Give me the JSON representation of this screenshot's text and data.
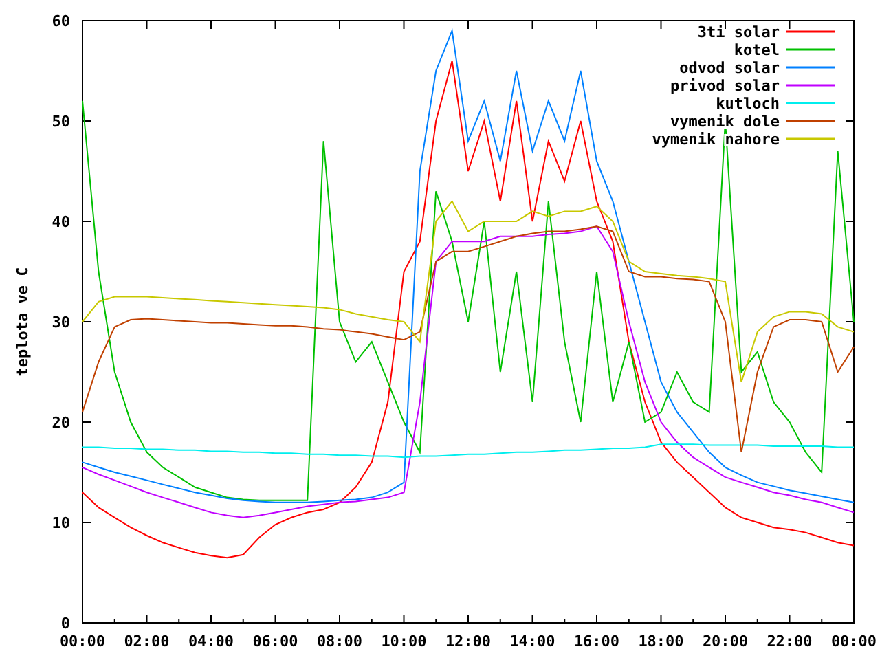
{
  "chart_data": {
    "type": "line",
    "ylabel": "teplota ve C",
    "legend": true,
    "x": [
      0,
      0.5,
      1,
      1.5,
      2,
      2.5,
      3,
      3.5,
      4,
      4.5,
      5,
      5.5,
      6,
      6.5,
      7,
      7.5,
      8,
      8.5,
      9,
      9.5,
      10,
      10.5,
      11,
      11.5,
      12,
      12.5,
      13,
      13.5,
      14,
      14.5,
      15,
      15.5,
      16,
      16.5,
      17,
      17.5,
      18,
      18.5,
      19,
      19.5,
      20,
      20.5,
      21,
      21.5,
      22,
      22.5,
      23,
      23.5,
      24
    ],
    "xlim": [
      0,
      24
    ],
    "ylim": [
      0,
      60
    ],
    "xticks": [
      {
        "value": 0,
        "label": "00:00"
      },
      {
        "value": 2,
        "label": "02:00"
      },
      {
        "value": 4,
        "label": "04:00"
      },
      {
        "value": 6,
        "label": "06:00"
      },
      {
        "value": 8,
        "label": "08:00"
      },
      {
        "value": 10,
        "label": "10:00"
      },
      {
        "value": 12,
        "label": "12:00"
      },
      {
        "value": 14,
        "label": "14:00"
      },
      {
        "value": 16,
        "label": "16:00"
      },
      {
        "value": 18,
        "label": "18:00"
      },
      {
        "value": 20,
        "label": "20:00"
      },
      {
        "value": 22,
        "label": "22:00"
      },
      {
        "value": 24,
        "label": "00:00"
      }
    ],
    "yticks": [
      0,
      10,
      20,
      30,
      40,
      50,
      60
    ],
    "series": [
      {
        "name": "3ti solar",
        "color": "#ff0000",
        "values": [
          13,
          11.5,
          10.5,
          9.5,
          8.7,
          8,
          7.5,
          7,
          6.7,
          6.5,
          6.8,
          8.5,
          9.8,
          10.5,
          11,
          11.3,
          12,
          13.5,
          16,
          22,
          35,
          38,
          50,
          56,
          45,
          50,
          42,
          52,
          40,
          48,
          44,
          50,
          42,
          38,
          28,
          22,
          18,
          16,
          14.5,
          13,
          11.5,
          10.5,
          10,
          9.5,
          9.3,
          9,
          8.5,
          8,
          7.7
        ]
      },
      {
        "name": "kotel",
        "color": "#00c000",
        "values": [
          52,
          35,
          25,
          20,
          17,
          15.5,
          14.5,
          13.5,
          13,
          12.5,
          12.3,
          12.2,
          12.2,
          12.2,
          12.2,
          48,
          30,
          26,
          28,
          24,
          20,
          17,
          43,
          38,
          30,
          40,
          25,
          35,
          22,
          42,
          28,
          20,
          35,
          22,
          28,
          20,
          21,
          25,
          22,
          21,
          50,
          25,
          27,
          22,
          20,
          17,
          15,
          47,
          30
        ]
      },
      {
        "name": "odvod solar",
        "color": "#0080ff",
        "values": [
          16,
          15.5,
          15,
          14.6,
          14.2,
          13.8,
          13.4,
          13,
          12.7,
          12.4,
          12.2,
          12.1,
          12,
          12,
          12,
          12.1,
          12.2,
          12.3,
          12.5,
          13,
          14,
          45,
          55,
          59,
          48,
          52,
          46,
          55,
          47,
          52,
          48,
          55,
          46,
          42,
          36,
          30,
          24,
          21,
          19,
          17,
          15.5,
          14.7,
          14,
          13.6,
          13.2,
          12.9,
          12.6,
          12.3,
          12
        ]
      },
      {
        "name": "privod solar",
        "color": "#c000ff",
        "values": [
          15.5,
          14.8,
          14.2,
          13.6,
          13,
          12.5,
          12,
          11.5,
          11,
          10.7,
          10.5,
          10.7,
          11,
          11.3,
          11.6,
          11.8,
          12,
          12.1,
          12.3,
          12.5,
          13,
          22,
          36,
          38,
          38,
          38,
          38.5,
          38.5,
          38.5,
          38.7,
          38.8,
          39,
          39.5,
          37,
          30,
          24,
          20,
          18,
          16.5,
          15.5,
          14.5,
          14,
          13.5,
          13,
          12.7,
          12.3,
          12,
          11.5,
          11
        ]
      },
      {
        "name": "kutloch",
        "color": "#00eeee",
        "values": [
          17.5,
          17.5,
          17.4,
          17.4,
          17.3,
          17.3,
          17.2,
          17.2,
          17.1,
          17.1,
          17,
          17,
          16.9,
          16.9,
          16.8,
          16.8,
          16.7,
          16.7,
          16.6,
          16.6,
          16.5,
          16.6,
          16.6,
          16.7,
          16.8,
          16.8,
          16.9,
          17,
          17,
          17.1,
          17.2,
          17.2,
          17.3,
          17.4,
          17.4,
          17.5,
          17.8,
          17.8,
          17.8,
          17.7,
          17.7,
          17.7,
          17.7,
          17.6,
          17.6,
          17.6,
          17.6,
          17.5,
          17.5
        ]
      },
      {
        "name": "vymenik dole",
        "color": "#c04000",
        "values": [
          21,
          26,
          29.5,
          30.2,
          30.3,
          30.2,
          30.1,
          30,
          29.9,
          29.9,
          29.8,
          29.7,
          29.6,
          29.6,
          29.5,
          29.3,
          29.2,
          29,
          28.8,
          28.5,
          28.2,
          29,
          36,
          37,
          37,
          37.5,
          38,
          38.5,
          38.8,
          39,
          39,
          39.2,
          39.5,
          39,
          35,
          34.5,
          34.5,
          34.3,
          34.2,
          34,
          30,
          17,
          25,
          29.5,
          30.2,
          30.2,
          30,
          25,
          27.5
        ]
      },
      {
        "name": "vymenik nahore",
        "color": "#c8c800",
        "values": [
          30,
          32,
          32.5,
          32.5,
          32.5,
          32.4,
          32.3,
          32.2,
          32.1,
          32,
          31.9,
          31.8,
          31.7,
          31.6,
          31.5,
          31.4,
          31.2,
          30.8,
          30.5,
          30.2,
          30,
          28,
          40,
          42,
          39,
          40,
          40,
          40,
          41,
          40.5,
          41,
          41,
          41.5,
          40,
          36,
          35,
          34.8,
          34.6,
          34.5,
          34.3,
          34,
          24,
          29,
          30.5,
          31,
          31,
          30.8,
          29.5,
          29
        ]
      }
    ]
  }
}
